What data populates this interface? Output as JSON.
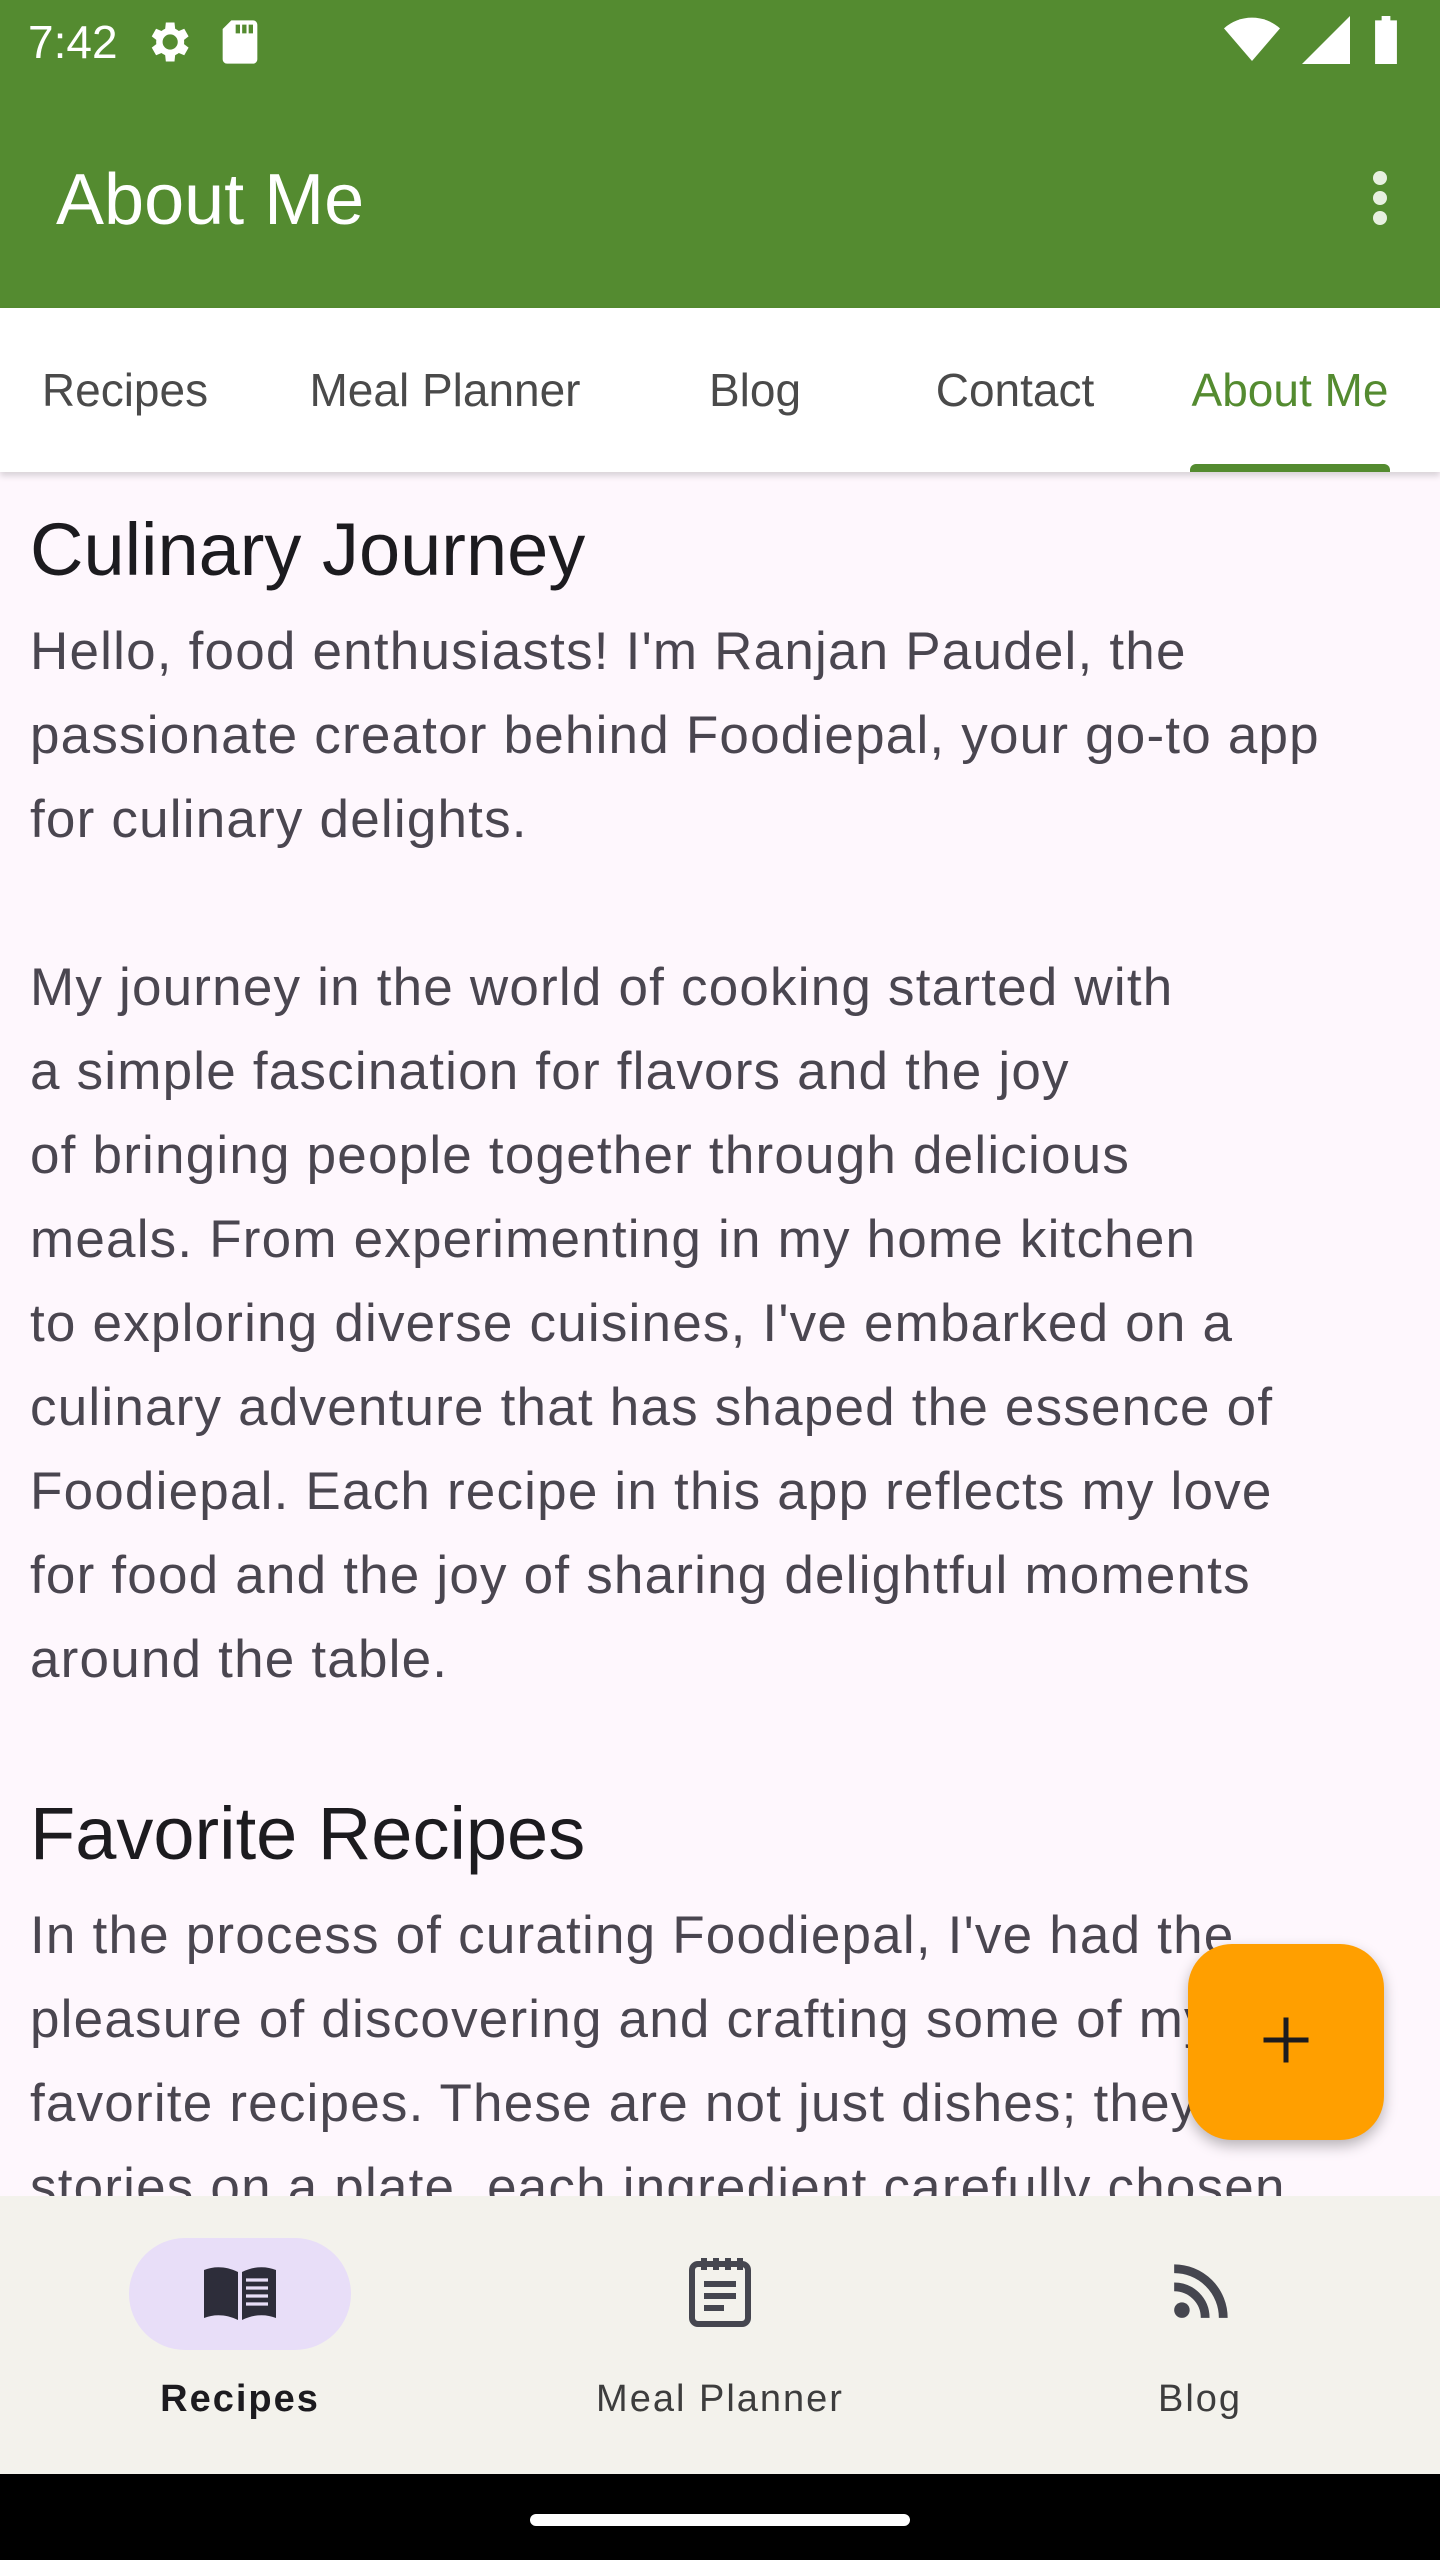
{
  "status_bar": {
    "time": "7:42"
  },
  "app_bar": {
    "title": "About Me"
  },
  "tabs": [
    {
      "label": "Recipes"
    },
    {
      "label": "Meal Planner"
    },
    {
      "label": "Blog"
    },
    {
      "label": "Contact"
    },
    {
      "label": "About Me",
      "active": true
    }
  ],
  "content": {
    "section1": {
      "heading": "Culinary Journey",
      "para1": "Hello, food enthusiasts! I'm Ranjan Paudel, the\npassionate creator behind Foodiepal, your go-to app\nfor culinary delights.",
      "para2": "My journey in the world of cooking started with\na simple fascination for flavors and the joy\nof bringing people together through delicious\nmeals. From experimenting in my home kitchen\nto exploring diverse cuisines, I've embarked on a\nculinary adventure that has shaped the essence of\nFoodiepal. Each recipe in this app reflects my love\nfor food and the joy of sharing delightful moments\naround the table."
    },
    "section2": {
      "heading": "Favorite Recipes",
      "para1": "In the process of curating Foodiepal, I've had the\npleasure of discovering and crafting some of my\nfavorite recipes. These are not just dishes; they are\nstories on a plate, each ingredient carefully chosen"
    }
  },
  "fab": {
    "icon": "plus-icon"
  },
  "bottom_nav": [
    {
      "label": "Recipes",
      "icon": "book-icon",
      "active": true
    },
    {
      "label": "Meal Planner",
      "icon": "notepad-icon"
    },
    {
      "label": "Blog",
      "icon": "rss-icon"
    }
  ],
  "colors": {
    "primary": "#548b30",
    "fab": "#ff9f00",
    "nav_pill": "#e8def8"
  }
}
